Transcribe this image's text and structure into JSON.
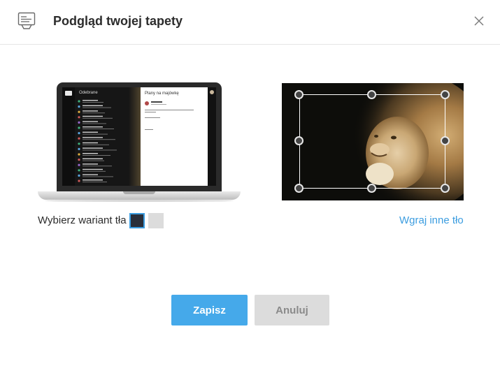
{
  "dialog": {
    "title": "Podgląd twojej tapety",
    "icons": {
      "header": "wallpaper-icon",
      "close": "close-icon"
    }
  },
  "preview": {
    "mail_folder": "Odebrane",
    "message_title": "Plany na majówkę",
    "mail_rows": 16
  },
  "variant": {
    "label": "Wybierz wariant tła",
    "options": [
      {
        "name": "dark",
        "color": "#2a2f3a",
        "selected": true
      },
      {
        "name": "light",
        "color": "#dcdcdc",
        "selected": false
      }
    ]
  },
  "upload_link": "Wgraj inne tło",
  "buttons": {
    "save": "Zapisz",
    "cancel": "Anuluj"
  },
  "colors": {
    "accent": "#45a9ea",
    "link": "#3c9de0",
    "cancel_bg": "#dcdcdc"
  }
}
